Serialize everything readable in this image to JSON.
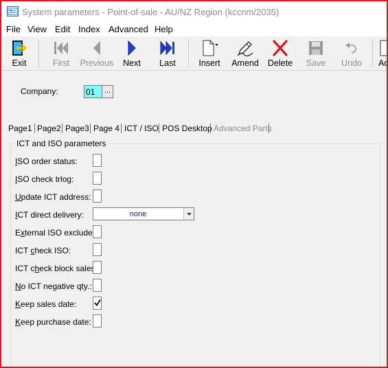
{
  "window": {
    "title": "System parameters - Point-of-sale - AU/NZ Region (kccnm/2035)"
  },
  "menu": [
    "File",
    "View",
    "Edit",
    "Index",
    "Advanced",
    "Help"
  ],
  "toolbar": {
    "exit": "Exit",
    "first": "First",
    "previous": "Previous",
    "next": "Next",
    "last": "Last",
    "insert": "Insert",
    "amend": "Amend",
    "delete": "Delete",
    "save": "Save",
    "undo": "Undo",
    "add": "Ad"
  },
  "company": {
    "label": "Company:",
    "value": "01",
    "browse": "..."
  },
  "tabs": [
    "Page1",
    "Page2",
    "Page3",
    "Page 4",
    "ICT / ISO",
    "POS Desktop",
    "Advanced Parts"
  ],
  "group": {
    "title": "ICT and ISO parameters",
    "fields": [
      {
        "key": "I",
        "rest": "SO order status:",
        "checked": false
      },
      {
        "key": "I",
        "rest": "SO check trlog:",
        "checked": false
      },
      {
        "key": "U",
        "rest": "pdate ICT address:",
        "checked": false
      },
      {
        "key": "I",
        "rest": "CT direct delivery:",
        "value": "none"
      },
      {
        "pre": "E",
        "key": "x",
        "rest": "ternal ISO exclude:",
        "checked": false
      },
      {
        "pre": "ICT ",
        "key": "c",
        "rest": "heck ISO:",
        "checked": false
      },
      {
        "pre": "ICT c",
        "key": "h",
        "rest": "eck block sales:",
        "checked": false
      },
      {
        "key": "N",
        "rest": "o ICT negative qty.:",
        "checked": false
      },
      {
        "key": "K",
        "rest": "eep sales date:",
        "checked": true
      },
      {
        "key": "K",
        "rest": "eep purchase date:",
        "checked": false
      }
    ]
  },
  "colors": {
    "accent_border": "#e81123",
    "company_field": "#80ffff",
    "nav_blue": "#1f3fd4",
    "delete_red": "#d61a1a"
  }
}
